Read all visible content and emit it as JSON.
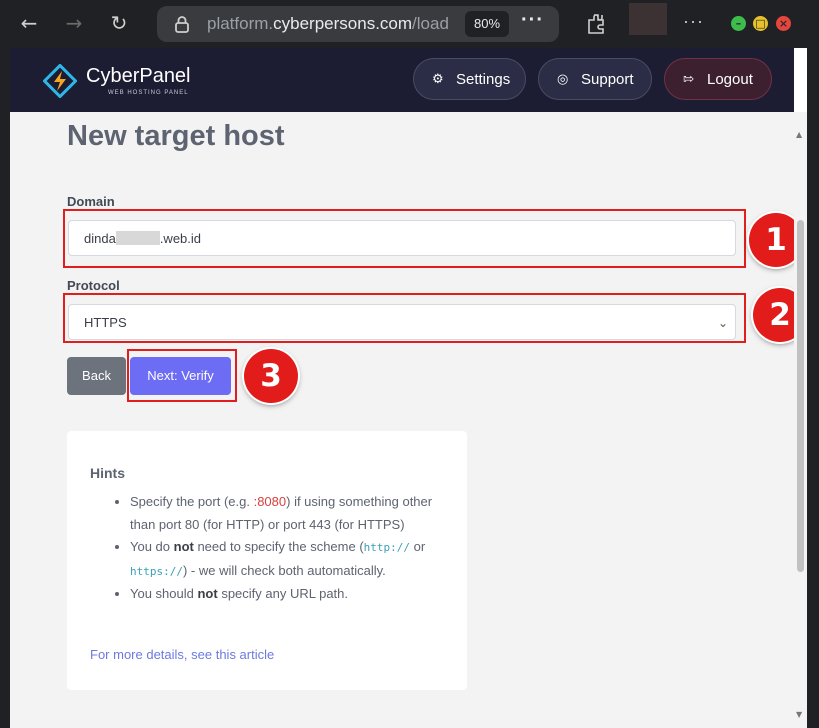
{
  "browser": {
    "url_host_prefix": "platform.",
    "url_host_main": "cyberpersons.com",
    "url_path": "/load",
    "zoom": "80%",
    "back_icon": "back-arrow-icon",
    "forward_icon": "forward-arrow-icon",
    "reload_icon": "reload-icon"
  },
  "header": {
    "logo_text": "CyberPanel",
    "logo_subtext": "WEB HOSTING PANEL",
    "settings_label": "Settings",
    "support_label": "Support",
    "logout_label": "Logout"
  },
  "form": {
    "title": "New target host",
    "domain_label": "Domain",
    "domain_value_prefix": "dinda",
    "domain_value_suffix": ".web.id",
    "protocol_label": "Protocol",
    "protocol_value": "HTTPS",
    "back_label": "Back",
    "next_label": "Next: Verify"
  },
  "annotations": [
    "1",
    "2",
    "3"
  ],
  "hints": {
    "title": "Hints",
    "item1_a": "Specify the port (e.g. ",
    "item1_port": ":8080",
    "item1_b": ") if using something other than port 80 (for HTTP) or port 443 (for HTTPS)",
    "item2_a": "You do ",
    "item2_not": "not",
    "item2_b": " need to specify the scheme (",
    "item2_code1": "http://",
    "item2_c": " or ",
    "item2_code2": "https://",
    "item2_d": ") - we will check both automatically.",
    "item3_a": "You should ",
    "item3_not": "not",
    "item3_b": " specify any URL path.",
    "link": "For more details, see this article"
  },
  "colors": {
    "accent": "#6c6cf5",
    "annotation_red": "#e21b1b",
    "navbar": "#1c1d33"
  }
}
